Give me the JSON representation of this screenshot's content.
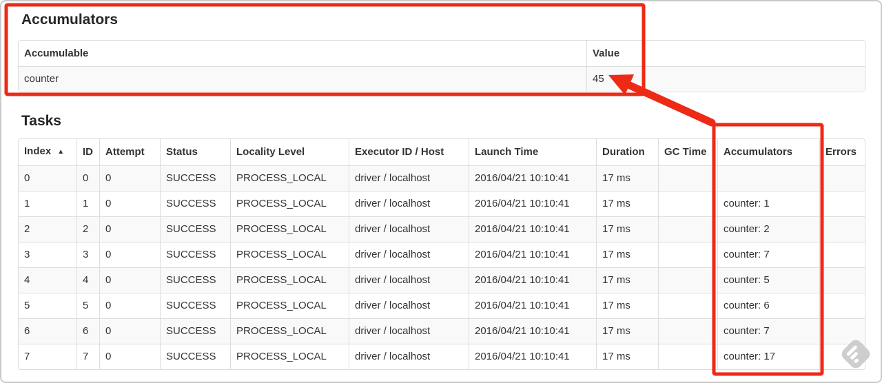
{
  "annotation": {
    "color": "#ed2a16"
  },
  "colors": {
    "stripe": "#f9f9f9",
    "table_border": "#dddddd",
    "text": "#333333",
    "watermark_gray": "#c6c6c6"
  },
  "icons": {
    "sort": "sort-ascending-triangle",
    "watermark": "diamond-stripes-watermark"
  },
  "accumulators": {
    "heading": "Accumulators",
    "table": {
      "columns": [
        "Accumulable",
        "Value"
      ],
      "rows": [
        [
          "counter",
          "45"
        ]
      ]
    }
  },
  "tasks": {
    "heading": "Tasks",
    "table": {
      "columns": [
        "Index",
        "ID",
        "Attempt",
        "Status",
        "Locality Level",
        "Executor ID / Host",
        "Launch Time",
        "Duration",
        "GC Time",
        "Accumulators",
        "Errors"
      ],
      "sort_arrow": "▲",
      "sorted_column_index": 0,
      "rows": [
        [
          "0",
          "0",
          "0",
          "SUCCESS",
          "PROCESS_LOCAL",
          "driver / localhost",
          "2016/04/21 10:10:41",
          "17 ms",
          "",
          "",
          ""
        ],
        [
          "1",
          "1",
          "0",
          "SUCCESS",
          "PROCESS_LOCAL",
          "driver / localhost",
          "2016/04/21 10:10:41",
          "17 ms",
          "",
          "counter: 1",
          ""
        ],
        [
          "2",
          "2",
          "0",
          "SUCCESS",
          "PROCESS_LOCAL",
          "driver / localhost",
          "2016/04/21 10:10:41",
          "17 ms",
          "",
          "counter: 2",
          ""
        ],
        [
          "3",
          "3",
          "0",
          "SUCCESS",
          "PROCESS_LOCAL",
          "driver / localhost",
          "2016/04/21 10:10:41",
          "17 ms",
          "",
          "counter: 7",
          ""
        ],
        [
          "4",
          "4",
          "0",
          "SUCCESS",
          "PROCESS_LOCAL",
          "driver / localhost",
          "2016/04/21 10:10:41",
          "17 ms",
          "",
          "counter: 5",
          ""
        ],
        [
          "5",
          "5",
          "0",
          "SUCCESS",
          "PROCESS_LOCAL",
          "driver / localhost",
          "2016/04/21 10:10:41",
          "17 ms",
          "",
          "counter: 6",
          ""
        ],
        [
          "6",
          "6",
          "0",
          "SUCCESS",
          "PROCESS_LOCAL",
          "driver / localhost",
          "2016/04/21 10:10:41",
          "17 ms",
          "",
          "counter: 7",
          ""
        ],
        [
          "7",
          "7",
          "0",
          "SUCCESS",
          "PROCESS_LOCAL",
          "driver / localhost",
          "2016/04/21 10:10:41",
          "17 ms",
          "",
          "counter: 17",
          ""
        ]
      ]
    }
  }
}
